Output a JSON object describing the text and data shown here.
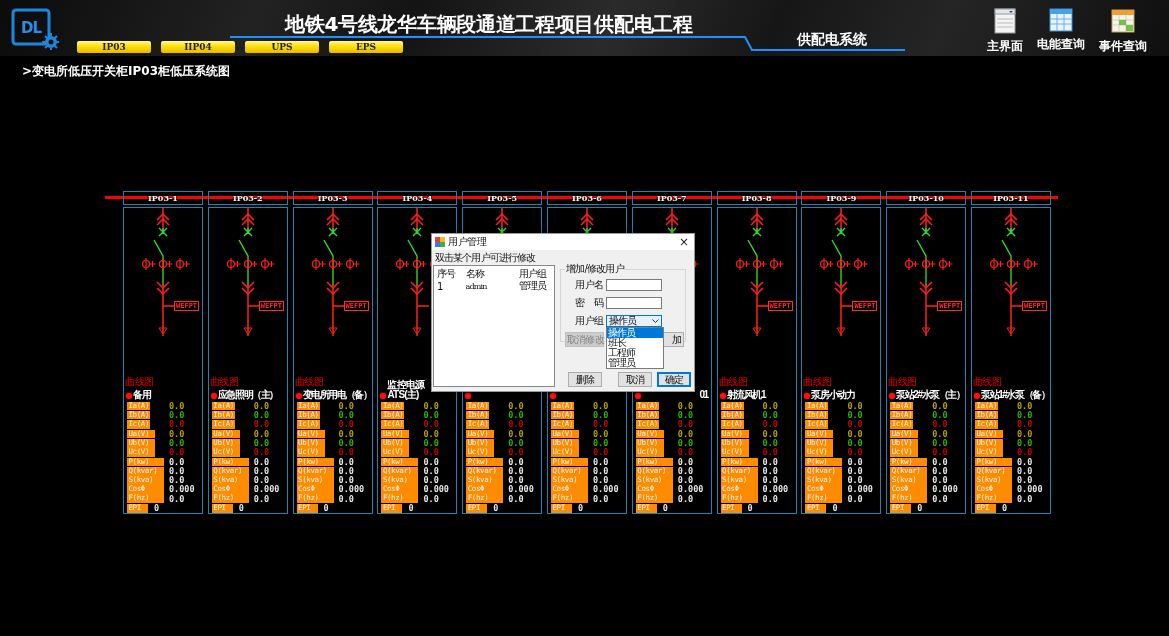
{
  "header": {
    "logo_text": "DL",
    "title": "地铁4号线龙华车辆段通道工程项目供配电工程",
    "subtitle": "供配电系统",
    "tabs": [
      {
        "label": "IP03"
      },
      {
        "label": "IIP04"
      },
      {
        "label": "UPS"
      },
      {
        "label": "EPS"
      }
    ],
    "nav": [
      {
        "kind": "window",
        "label": "主界面"
      },
      {
        "kind": "table",
        "label": "电能查询"
      },
      {
        "kind": "calendar",
        "label": "事件查询"
      }
    ]
  },
  "breadcrumb": ">变电所低压开关柜IP03柜低压系统图",
  "panels": [
    {
      "header": "IP03-1",
      "tag": "WEFPT",
      "curve_label": "曲线图",
      "name": "备用",
      "kind": "full",
      "readings": [
        {
          "kind": "current",
          "label": "Ia(A)",
          "value": "0.0",
          "color": "#b4a000"
        },
        {
          "kind": "current",
          "label": "Ib(A)",
          "value": "0.0",
          "color": "#2fb000"
        },
        {
          "kind": "current",
          "label": "Ic(A)",
          "value": "0.0",
          "color": "#c00000"
        },
        {
          "kind": "voltage",
          "label": "Ua(V)",
          "value": "0.0",
          "color": "#b4a000"
        },
        {
          "kind": "voltage",
          "label": "Ub(V)",
          "value": "0.0",
          "color": "#2fb000"
        },
        {
          "kind": "voltage",
          "label": "Uc(V)",
          "value": "0.0",
          "color": "#c00000"
        },
        {
          "kind": "power",
          "label": "P(kw)",
          "value": "0.0",
          "color": "#e6e6e6"
        },
        {
          "kind": "power",
          "label": "Q(kvar)",
          "value": "0.0",
          "color": "#e6e6e6"
        },
        {
          "kind": "power",
          "label": "S(kva)",
          "value": "0.0",
          "color": "#e6e6e6"
        },
        {
          "kind": "power",
          "label": "CosΦ",
          "value": "0.000",
          "color": "#e6e6e6"
        },
        {
          "kind": "power",
          "label": "F(hz)",
          "value": "0.0",
          "color": "#e6e6e6"
        },
        {
          "kind": "energy",
          "label": "EPI",
          "value": "0",
          "color": "#e6e6e6"
        }
      ]
    },
    {
      "header": "IP03-2",
      "tag": "WEFPT",
      "curve_label": "曲线图",
      "name": "应急照明（主）",
      "kind": "full",
      "readings": [
        {
          "kind": "current",
          "label": "Ia(A)",
          "value": "0.0",
          "color": "#b4a000"
        },
        {
          "kind": "current",
          "label": "Ib(A)",
          "value": "0.0",
          "color": "#2fb000"
        },
        {
          "kind": "current",
          "label": "Ic(A)",
          "value": "0.0",
          "color": "#c00000"
        },
        {
          "kind": "voltage",
          "label": "Ua(V)",
          "value": "0.0",
          "color": "#b4a000"
        },
        {
          "kind": "voltage",
          "label": "Ub(V)",
          "value": "0.0",
          "color": "#2fb000"
        },
        {
          "kind": "voltage",
          "label": "Uc(V)",
          "value": "0.0",
          "color": "#c00000"
        },
        {
          "kind": "power",
          "label": "P(kw)",
          "value": "0.0",
          "color": "#e6e6e6"
        },
        {
          "kind": "power",
          "label": "Q(kvar)",
          "value": "0.0",
          "color": "#e6e6e6"
        },
        {
          "kind": "power",
          "label": "S(kva)",
          "value": "0.0",
          "color": "#e6e6e6"
        },
        {
          "kind": "power",
          "label": "CosΦ",
          "value": "0.000",
          "color": "#e6e6e6"
        },
        {
          "kind": "power",
          "label": "F(hz)",
          "value": "0.0",
          "color": "#e6e6e6"
        },
        {
          "kind": "energy",
          "label": "EPI",
          "value": "0",
          "color": "#e6e6e6"
        }
      ]
    },
    {
      "header": "IP03-3",
      "tag": "WEFPT",
      "curve_label": "曲线图",
      "name": "变电所用电（备）",
      "kind": "full",
      "readings": [
        {
          "kind": "current",
          "label": "Ia(A)",
          "value": "0.0",
          "color": "#b4a000"
        },
        {
          "kind": "current",
          "label": "Ib(A)",
          "value": "0.0",
          "color": "#2fb000"
        },
        {
          "kind": "current",
          "label": "Ic(A)",
          "value": "0.0",
          "color": "#c00000"
        },
        {
          "kind": "voltage",
          "label": "Ua(V)",
          "value": "0.0",
          "color": "#b4a000"
        },
        {
          "kind": "voltage",
          "label": "Ub(V)",
          "value": "0.0",
          "color": "#2fb000"
        },
        {
          "kind": "voltage",
          "label": "Uc(V)",
          "value": "0.0",
          "color": "#c00000"
        },
        {
          "kind": "power",
          "label": "P(kw)",
          "value": "0.0",
          "color": "#e6e6e6"
        },
        {
          "kind": "power",
          "label": "Q(kvar)",
          "value": "0.0",
          "color": "#e6e6e6"
        },
        {
          "kind": "power",
          "label": "S(kva)",
          "value": "0.0",
          "color": "#e6e6e6"
        },
        {
          "kind": "power",
          "label": "CosΦ",
          "value": "0.000",
          "color": "#e6e6e6"
        },
        {
          "kind": "power",
          "label": "F(hz)",
          "value": "0.0",
          "color": "#e6e6e6"
        },
        {
          "kind": "energy",
          "label": "EPI",
          "value": "0",
          "color": "#e6e6e6"
        }
      ]
    },
    {
      "header": "IP03-4",
      "name": "监控电源ATS(主)",
      "kind": "left_part",
      "readings": [
        {
          "kind": "current",
          "label": "Ia(A)",
          "value": "0.0",
          "color": "#b4a000"
        },
        {
          "kind": "current",
          "label": "Ib(A)",
          "value": "0.0",
          "color": "#2fb000"
        },
        {
          "kind": "current",
          "label": "Ic(A)",
          "value": "0.0",
          "color": "#c00000"
        },
        {
          "kind": "voltage",
          "label": "Ua(V)",
          "value": "0.0",
          "color": "#b4a000"
        },
        {
          "kind": "voltage",
          "label": "Ub(V)",
          "value": "0.0",
          "color": "#2fb000"
        },
        {
          "kind": "voltage",
          "label": "Uc(V)",
          "value": "0.0",
          "color": "#c00000"
        },
        {
          "kind": "power",
          "label": "P(kw)",
          "value": "0.0",
          "color": "#e6e6e6"
        },
        {
          "kind": "power",
          "label": "Q(kvar)",
          "value": "0.0",
          "color": "#e6e6e6"
        },
        {
          "kind": "power",
          "label": "S(kva)",
          "value": "0.0",
          "color": "#e6e6e6"
        },
        {
          "kind": "power",
          "label": "CosΦ",
          "value": "0.000",
          "color": "#e6e6e6"
        },
        {
          "kind": "power",
          "label": "F(hz)",
          "value": "0.0",
          "color": "#e6e6e6"
        },
        {
          "kind": "energy",
          "label": "EPI",
          "value": "0",
          "color": "#e6e6e6"
        }
      ]
    },
    {
      "header": "IP03-5",
      "readings": [
        {
          "kind": "current",
          "label": "Ia(A)",
          "value": "0.0",
          "color": "#b4a000"
        },
        {
          "kind": "current",
          "label": "Ib(A)",
          "value": "0.0",
          "color": "#2fb000"
        },
        {
          "kind": "current",
          "label": "Ic(A)",
          "value": "0.0",
          "color": "#c00000"
        },
        {
          "kind": "voltage",
          "label": "Ua(V)",
          "value": "0.0",
          "color": "#b4a000"
        },
        {
          "kind": "voltage",
          "label": "Ub(V)",
          "value": "0.0",
          "color": "#2fb000"
        },
        {
          "kind": "voltage",
          "label": "Uc(V)",
          "value": "0.0",
          "color": "#c00000"
        },
        {
          "kind": "power",
          "label": "P(kw)",
          "value": "0.0",
          "color": "#e6e6e6"
        },
        {
          "kind": "power",
          "label": "Q(kvar)",
          "value": "0.0",
          "color": "#e6e6e6"
        },
        {
          "kind": "power",
          "label": "S(kva)",
          "value": "0.0",
          "color": "#e6e6e6"
        },
        {
          "kind": "power",
          "label": "CosΦ",
          "value": "0.000",
          "color": "#e6e6e6"
        },
        {
          "kind": "power",
          "label": "F(hz)",
          "value": "0.0",
          "color": "#e6e6e6"
        },
        {
          "kind": "energy",
          "label": "EPI",
          "value": "0",
          "color": "#e6e6e6"
        }
      ]
    },
    {
      "header": "IP03-6",
      "readings": [
        {
          "kind": "current",
          "label": "Ia(A)",
          "value": "0.0",
          "color": "#b4a000"
        },
        {
          "kind": "current",
          "label": "Ib(A)",
          "value": "0.0",
          "color": "#2fb000"
        },
        {
          "kind": "current",
          "label": "Ic(A)",
          "value": "0.0",
          "color": "#c00000"
        },
        {
          "kind": "voltage",
          "label": "Ua(V)",
          "value": "0.0",
          "color": "#b4a000"
        },
        {
          "kind": "voltage",
          "label": "Ub(V)",
          "value": "0.0",
          "color": "#2fb000"
        },
        {
          "kind": "voltage",
          "label": "Uc(V)",
          "value": "0.0",
          "color": "#c00000"
        },
        {
          "kind": "power",
          "label": "P(kw)",
          "value": "0.0",
          "color": "#e6e6e6"
        },
        {
          "kind": "power",
          "label": "Q(kvar)",
          "value": "0.0",
          "color": "#e6e6e6"
        },
        {
          "kind": "power",
          "label": "S(kva)",
          "value": "0.0",
          "color": "#e6e6e6"
        },
        {
          "kind": "power",
          "label": "CosΦ",
          "value": "0.000",
          "color": "#e6e6e6"
        },
        {
          "kind": "power",
          "label": "F(hz)",
          "value": "0.0",
          "color": "#e6e6e6"
        },
        {
          "kind": "energy",
          "label": "EPI",
          "value": "0",
          "color": "#e6e6e6"
        }
      ]
    },
    {
      "header": "IP03-7",
      "name": "01",
      "kind": "right_part",
      "readings": [
        {
          "kind": "current",
          "label": "Ia(A)",
          "value": "0.0",
          "color": "#b4a000"
        },
        {
          "kind": "current",
          "label": "Ib(A)",
          "value": "0.0",
          "color": "#2fb000"
        },
        {
          "kind": "current",
          "label": "Ic(A)",
          "value": "0.0",
          "color": "#c00000"
        },
        {
          "kind": "voltage",
          "label": "Ua(V)",
          "value": "0.0",
          "color": "#b4a000"
        },
        {
          "kind": "voltage",
          "label": "Ub(V)",
          "value": "0.0",
          "color": "#2fb000"
        },
        {
          "kind": "voltage",
          "label": "Uc(V)",
          "value": "0.0",
          "color": "#c00000"
        },
        {
          "kind": "power",
          "label": "P(kw)",
          "value": "0.0",
          "color": "#e6e6e6"
        },
        {
          "kind": "power",
          "label": "Q(kvar)",
          "value": "0.0",
          "color": "#e6e6e6"
        },
        {
          "kind": "power",
          "label": "S(kva)",
          "value": "0.0",
          "color": "#e6e6e6"
        },
        {
          "kind": "power",
          "label": "CosΦ",
          "value": "0.000",
          "color": "#e6e6e6"
        },
        {
          "kind": "power",
          "label": "F(hz)",
          "value": "0.0",
          "color": "#e6e6e6"
        },
        {
          "kind": "energy",
          "label": "EPI",
          "value": "0",
          "color": "#e6e6e6"
        }
      ]
    },
    {
      "header": "IP03-8",
      "tag": "WEFPT",
      "curve_label": "曲线图",
      "name": "射流风机1",
      "kind": "full",
      "readings": [
        {
          "kind": "current",
          "label": "Ia(A)",
          "value": "0.0",
          "color": "#b4a000"
        },
        {
          "kind": "current",
          "label": "Ib(A)",
          "value": "0.0",
          "color": "#2fb000"
        },
        {
          "kind": "current",
          "label": "Ic(A)",
          "value": "0.0",
          "color": "#c00000"
        },
        {
          "kind": "voltage",
          "label": "Ua(V)",
          "value": "0.0",
          "color": "#b4a000"
        },
        {
          "kind": "voltage",
          "label": "Ub(V)",
          "value": "0.0",
          "color": "#2fb000"
        },
        {
          "kind": "voltage",
          "label": "Uc(V)",
          "value": "0.0",
          "color": "#c00000"
        },
        {
          "kind": "power",
          "label": "P(kw)",
          "value": "0.0",
          "color": "#e6e6e6"
        },
        {
          "kind": "power",
          "label": "Q(kvar)",
          "value": "0.0",
          "color": "#e6e6e6"
        },
        {
          "kind": "power",
          "label": "S(kva)",
          "value": "0.0",
          "color": "#e6e6e6"
        },
        {
          "kind": "power",
          "label": "CosΦ",
          "value": "0.000",
          "color": "#e6e6e6"
        },
        {
          "kind": "power",
          "label": "F(hz)",
          "value": "0.0",
          "color": "#e6e6e6"
        },
        {
          "kind": "energy",
          "label": "EPI",
          "value": "0",
          "color": "#e6e6e6"
        }
      ]
    },
    {
      "header": "IP03-9",
      "tag": "WEFPT",
      "curve_label": "曲线图",
      "name": "泵房小动力",
      "kind": "full",
      "readings": [
        {
          "kind": "current",
          "label": "Ia(A)",
          "value": "0.0",
          "color": "#b4a000"
        },
        {
          "kind": "current",
          "label": "Ib(A)",
          "value": "0.0",
          "color": "#2fb000"
        },
        {
          "kind": "current",
          "label": "Ic(A)",
          "value": "0.0",
          "color": "#c00000"
        },
        {
          "kind": "voltage",
          "label": "Ua(V)",
          "value": "0.0",
          "color": "#b4a000"
        },
        {
          "kind": "voltage",
          "label": "Ub(V)",
          "value": "0.0",
          "color": "#2fb000"
        },
        {
          "kind": "voltage",
          "label": "Uc(V)",
          "value": "0.0",
          "color": "#c00000"
        },
        {
          "kind": "power",
          "label": "P(kw)",
          "value": "0.0",
          "color": "#e6e6e6"
        },
        {
          "kind": "power",
          "label": "Q(kvar)",
          "value": "0.0",
          "color": "#e6e6e6"
        },
        {
          "kind": "power",
          "label": "S(kva)",
          "value": "0.0",
          "color": "#e6e6e6"
        },
        {
          "kind": "power",
          "label": "CosΦ",
          "value": "0.000",
          "color": "#e6e6e6"
        },
        {
          "kind": "power",
          "label": "F(hz)",
          "value": "0.0",
          "color": "#e6e6e6"
        },
        {
          "kind": "energy",
          "label": "EPI",
          "value": "0",
          "color": "#e6e6e6"
        }
      ]
    },
    {
      "header": "IP03-10",
      "tag": "WEFPT",
      "curve_label": "曲线图",
      "name": "泵站2#水泵（主）",
      "kind": "full",
      "readings": [
        {
          "kind": "current",
          "label": "Ia(A)",
          "value": "0.0",
          "color": "#b4a000"
        },
        {
          "kind": "current",
          "label": "Ib(A)",
          "value": "0.0",
          "color": "#2fb000"
        },
        {
          "kind": "current",
          "label": "Ic(A)",
          "value": "0.0",
          "color": "#c00000"
        },
        {
          "kind": "voltage",
          "label": "Ua(V)",
          "value": "0.0",
          "color": "#b4a000"
        },
        {
          "kind": "voltage",
          "label": "Ub(V)",
          "value": "0.0",
          "color": "#2fb000"
        },
        {
          "kind": "voltage",
          "label": "Uc(V)",
          "value": "0.0",
          "color": "#c00000"
        },
        {
          "kind": "power",
          "label": "P(kw)",
          "value": "0.0",
          "color": "#e6e6e6"
        },
        {
          "kind": "power",
          "label": "Q(kvar)",
          "value": "0.0",
          "color": "#e6e6e6"
        },
        {
          "kind": "power",
          "label": "S(kva)",
          "value": "0.0",
          "color": "#e6e6e6"
        },
        {
          "kind": "power",
          "label": "CosΦ",
          "value": "0.000",
          "color": "#e6e6e6"
        },
        {
          "kind": "power",
          "label": "F(hz)",
          "value": "0.0",
          "color": "#e6e6e6"
        },
        {
          "kind": "energy",
          "label": "EPI",
          "value": "0",
          "color": "#e6e6e6"
        }
      ]
    },
    {
      "header": "IP03-11",
      "tag": "WEFPT",
      "curve_label": "曲线图",
      "name": "泵站1#水泵（备）",
      "kind": "full",
      "readings": [
        {
          "kind": "current",
          "label": "Ia(A)",
          "value": "0.0",
          "color": "#b4a000"
        },
        {
          "kind": "current",
          "label": "Ib(A)",
          "value": "0.0",
          "color": "#2fb000"
        },
        {
          "kind": "current",
          "label": "Ic(A)",
          "value": "0.0",
          "color": "#c00000"
        },
        {
          "kind": "voltage",
          "label": "Ua(V)",
          "value": "0.0",
          "color": "#b4a000"
        },
        {
          "kind": "voltage",
          "label": "Ub(V)",
          "value": "0.0",
          "color": "#2fb000"
        },
        {
          "kind": "voltage",
          "label": "Uc(V)",
          "value": "0.0",
          "color": "#c00000"
        },
        {
          "kind": "power",
          "label": "P(kw)",
          "value": "0.0",
          "color": "#e6e6e6"
        },
        {
          "kind": "power",
          "label": "Q(kvar)",
          "value": "0.0",
          "color": "#e6e6e6"
        },
        {
          "kind": "power",
          "label": "S(kva)",
          "value": "0.0",
          "color": "#e6e6e6"
        },
        {
          "kind": "power",
          "label": "CosΦ",
          "value": "0.000",
          "color": "#e6e6e6"
        },
        {
          "kind": "power",
          "label": "F(hz)",
          "value": "0.0",
          "color": "#e6e6e6"
        },
        {
          "kind": "energy",
          "label": "EPI",
          "value": "0",
          "color": "#e6e6e6"
        }
      ]
    }
  ],
  "dialog": {
    "title": "用户管理",
    "close": "×",
    "list_hint": "双击某个用户可进行修改",
    "list_columns": [
      "序号",
      "名称",
      "用户组"
    ],
    "list_rows": [
      [
        "1",
        "admin",
        "管理员"
      ]
    ],
    "group_title": "增加/修改用户",
    "fields": [
      {
        "kind": "text",
        "label": "用户名"
      },
      {
        "kind": "text",
        "label": "密　码"
      },
      {
        "kind": "select",
        "label": "用户组",
        "value": "操作员",
        "expanded": true,
        "options": [
          {
            "label": "操作员",
            "selected": true
          },
          {
            "label": "班长",
            "selected": false
          },
          {
            "label": "工程师",
            "selected": false
          },
          {
            "label": "管理员",
            "selected": false
          }
        ]
      }
    ],
    "group_buttons": [
      {
        "label": "取消修改",
        "disabled": true
      },
      {
        "label": "加",
        "disabled": false
      }
    ],
    "buttons": [
      {
        "label": "删除",
        "focused": false
      },
      {
        "label": "取消",
        "focused": false
      },
      {
        "label": "确定",
        "focused": true
      }
    ]
  }
}
